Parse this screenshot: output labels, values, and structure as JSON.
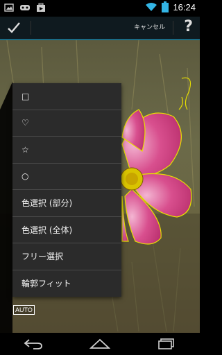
{
  "status_bar": {
    "time": "16:24",
    "left_icons": [
      "image-icon",
      "gamepad-icon",
      "play-store-icon"
    ],
    "right_icons": [
      "wifi-icon",
      "battery-icon"
    ]
  },
  "action_bar": {
    "cancel_label": "キャンセル",
    "help_label": "?"
  },
  "menu": {
    "items": [
      {
        "label": "□"
      },
      {
        "label": "♡"
      },
      {
        "label": "☆"
      },
      {
        "label": "○"
      },
      {
        "label": "色選択 (部分)"
      },
      {
        "label": "色選択 (全体)"
      },
      {
        "label": "フリー選択"
      },
      {
        "label": "輪郭フィット"
      }
    ]
  },
  "auto_badge": "AUTO",
  "nav_bar": {
    "buttons": [
      "back-icon",
      "home-icon",
      "recent-apps-icon"
    ]
  },
  "colors": {
    "action_bar_bg": "#0f1a1f",
    "accent_line": "#1a6c86",
    "menu_bg": "#2b2b2b",
    "selection_outline": "#e8e000",
    "flower_pink": "#d84f8e"
  }
}
